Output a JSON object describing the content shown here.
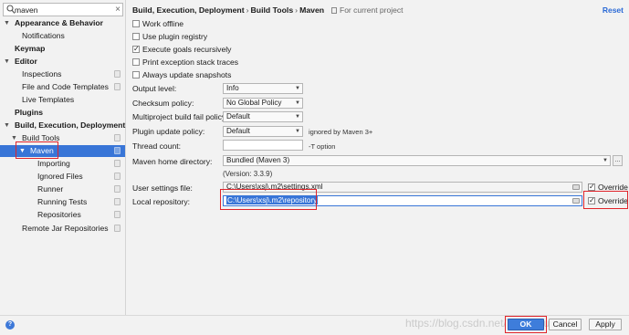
{
  "search": {
    "value": "maven"
  },
  "tree": {
    "appearance": "Appearance & Behavior",
    "notifications": "Notifications",
    "keymap": "Keymap",
    "editor": "Editor",
    "inspections": "Inspections",
    "file_templates": "File and Code Templates",
    "live_templates": "Live Templates",
    "plugins": "Plugins",
    "build": "Build, Execution, Deployment",
    "build_tools": "Build Tools",
    "maven": "Maven",
    "importing": "Importing",
    "ignored_files": "Ignored Files",
    "runner": "Runner",
    "running_tests": "Running Tests",
    "repositories": "Repositories",
    "remote_jar": "Remote Jar Repositories"
  },
  "header": {
    "crumb1": "Build, Execution, Deployment",
    "crumb2": "Build Tools",
    "crumb3": "Maven",
    "separator": "›",
    "project_note": "For current project",
    "reset": "Reset"
  },
  "checks": {
    "work_offline": "Work offline",
    "plugin_registry": "Use plugin registry",
    "execute_goals": "Execute goals recursively",
    "print_trace": "Print exception stack traces",
    "always_update": "Always update snapshots"
  },
  "fields": {
    "output_level_label": "Output level:",
    "output_level_value": "Info",
    "checksum_label": "Checksum policy:",
    "checksum_value": "No Global Policy",
    "multiproject_label": "Multiproject build fail policy:",
    "multiproject_value": "Default",
    "plugin_update_label": "Plugin update policy:",
    "plugin_update_value": "Default",
    "plugin_update_hint": "ignored by Maven 3+",
    "thread_label": "Thread count:",
    "thread_value": "",
    "thread_hint": "-T option",
    "home_label": "Maven home directory:",
    "home_value": "Bundled (Maven 3)",
    "home_version": "(Version: 3.3.9)",
    "settings_label": "User settings file:",
    "settings_value": "C:\\Users\\xsj\\.m2\\settings.xml",
    "settings_override": "Override",
    "repo_label": "Local repository:",
    "repo_value": "C:\\Users\\xsj\\.m2\\repository",
    "repo_override": "Override"
  },
  "buttons": {
    "ok": "OK",
    "cancel": "Cancel",
    "apply": "Apply",
    "help": "?"
  },
  "watermark": "https://blog.csdn.net/YBlogHub_li",
  "colors": {
    "selection": "#3875d7",
    "highlight_box": "#e0242a",
    "reset_link": "#2b6ad6"
  }
}
